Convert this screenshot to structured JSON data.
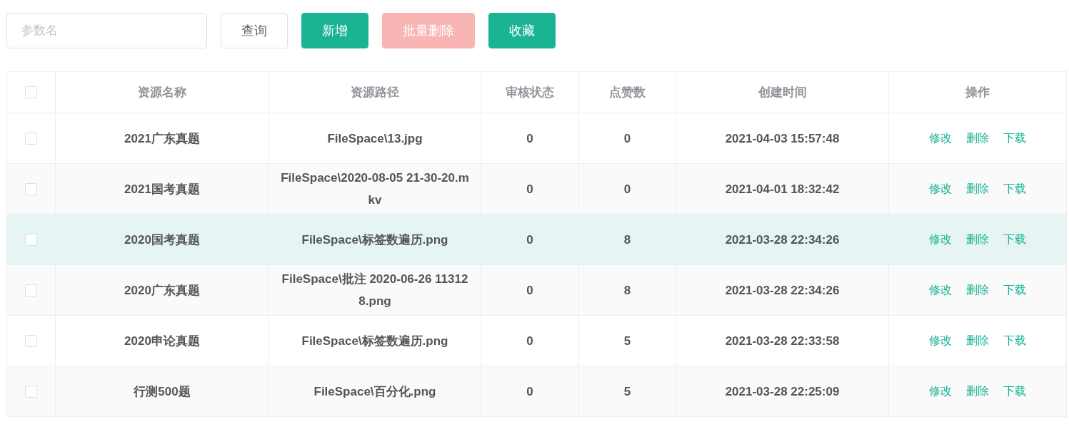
{
  "toolbar": {
    "search": {
      "placeholder": "参数名"
    },
    "buttons": [
      {
        "label": "查询",
        "kind": "plain",
        "disabled": false
      },
      {
        "label": "新增",
        "kind": "primary",
        "disabled": false
      },
      {
        "label": "批量删除",
        "kind": "danger",
        "disabled": true
      },
      {
        "label": "收藏",
        "kind": "primary",
        "disabled": false
      }
    ]
  },
  "table": {
    "header_checkbox": {
      "checked": false
    },
    "columns": [
      "资源名称",
      "资源路径",
      "审核状态",
      "点赞数",
      "创建时间",
      "操作"
    ],
    "rows": [
      {
        "checked": false,
        "highlighted": false,
        "cells": [
          "2021广东真题",
          "FileSpace\\13.jpg",
          "0",
          "0",
          "2021-04-03 15:57:48"
        ],
        "actions": [
          "修改",
          "删除",
          "下载"
        ]
      },
      {
        "checked": false,
        "highlighted": false,
        "cells": [
          "2021国考真题",
          "FileSpace\\2020-08-05 21-30-20.mkv",
          "0",
          "0",
          "2021-04-01 18:32:42"
        ],
        "actions": [
          "修改",
          "删除",
          "下载"
        ]
      },
      {
        "checked": false,
        "highlighted": true,
        "cells": [
          "2020国考真题",
          "FileSpace\\标签数遍历.png",
          "0",
          "8",
          "2021-03-28 22:34:26"
        ],
        "actions": [
          "修改",
          "删除",
          "下载"
        ]
      },
      {
        "checked": false,
        "highlighted": false,
        "cells": [
          "2020广东真题",
          "FileSpace\\批注 2020-06-26 113128.png",
          "0",
          "8",
          "2021-03-28 22:34:26"
        ],
        "actions": [
          "修改",
          "删除",
          "下载"
        ]
      },
      {
        "checked": false,
        "highlighted": false,
        "cells": [
          "2020申论真题",
          "FileSpace\\标签数遍历.png",
          "0",
          "5",
          "2021-03-28 22:33:58"
        ],
        "actions": [
          "修改",
          "删除",
          "下载"
        ]
      },
      {
        "checked": false,
        "highlighted": false,
        "cells": [
          "行测500题",
          "FileSpace\\百分化.png",
          "0",
          "5",
          "2021-03-28 22:25:09"
        ],
        "actions": [
          "修改",
          "删除",
          "下载"
        ]
      }
    ]
  }
}
